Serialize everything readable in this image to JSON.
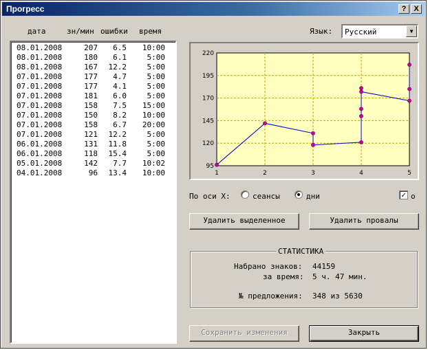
{
  "window": {
    "title": "Прогресс",
    "help_label": "?",
    "close_label": "X"
  },
  "list": {
    "headers": {
      "date": "дата",
      "speed": "зн/мин",
      "errors": "ошибки",
      "time": "время"
    },
    "rows": [
      {
        "date": "08.01.2008",
        "speed": "207",
        "errors": "6.5",
        "time": "10:00"
      },
      {
        "date": "08.01.2008",
        "speed": "180",
        "errors": "6.1",
        "time": "5:00"
      },
      {
        "date": "08.01.2008",
        "speed": "167",
        "errors": "12.2",
        "time": "5:00"
      },
      {
        "date": "07.01.2008",
        "speed": "177",
        "errors": "4.7",
        "time": "5:00"
      },
      {
        "date": "07.01.2008",
        "speed": "177",
        "errors": "4.1",
        "time": "5:00"
      },
      {
        "date": "07.01.2008",
        "speed": "181",
        "errors": "6.0",
        "time": "5:00"
      },
      {
        "date": "07.01.2008",
        "speed": "158",
        "errors": "7.5",
        "time": "15:00"
      },
      {
        "date": "07.01.2008",
        "speed": "150",
        "errors": "8.2",
        "time": "10:00"
      },
      {
        "date": "07.01.2008",
        "speed": "158",
        "errors": "6.7",
        "time": "20:00"
      },
      {
        "date": "07.01.2008",
        "speed": "121",
        "errors": "12.2",
        "time": "5:00"
      },
      {
        "date": "06.01.2008",
        "speed": "131",
        "errors": "11.8",
        "time": "5:00"
      },
      {
        "date": "06.01.2008",
        "speed": "118",
        "errors": "15.4",
        "time": "5:00"
      },
      {
        "date": "05.01.2008",
        "speed": "142",
        "errors": "7.7",
        "time": "10:02"
      },
      {
        "date": "04.01.2008",
        "speed": "96",
        "errors": "13.4",
        "time": "10:00"
      }
    ]
  },
  "language": {
    "label": "Язык:",
    "selected": "Русский"
  },
  "chart_data": {
    "type": "line",
    "x_ticks": [
      "1",
      "2",
      "3",
      "4",
      "5"
    ],
    "y_ticks": [
      "95",
      "120",
      "145",
      "170",
      "195",
      "220"
    ],
    "ylim": [
      95,
      220
    ],
    "xlim": [
      1,
      5
    ],
    "grid": true,
    "plot_background": "#ffffc0",
    "line_color": "#0000cc",
    "marker_color": "#cc0099",
    "points": [
      {
        "x": 1,
        "y": 96
      },
      {
        "x": 2,
        "y": 142
      },
      {
        "x": 3,
        "y": 131
      },
      {
        "x": 3,
        "y": 118
      },
      {
        "x": 4,
        "y": 121
      },
      {
        "x": 4,
        "y": 150
      },
      {
        "x": 4,
        "y": 158
      },
      {
        "x": 4,
        "y": 181
      },
      {
        "x": 4,
        "y": 177
      },
      {
        "x": 5,
        "y": 167
      },
      {
        "x": 5,
        "y": 180
      },
      {
        "x": 5,
        "y": 207
      }
    ]
  },
  "axis_mode": {
    "label": "По оси X:",
    "option_sessions": "сеансы",
    "option_days": "дни",
    "selected": "дни"
  },
  "checkbox": {
    "label": "о",
    "checked": true,
    "mark": "✓"
  },
  "buttons": {
    "delete_selected": "Удалить выделенное",
    "delete_failures": "Удалить провалы",
    "save_changes": "Сохранить изменения",
    "close": "Закрыть"
  },
  "stats": {
    "title": "СТАТИСТИКА",
    "typed_label": "Набрано знаков:",
    "typed_value": "44159",
    "time_label": "за время:",
    "time_value": "5 ч. 47 мин.",
    "sentence_label": "№ предложения:",
    "sentence_value": "348 из 5630"
  },
  "icons": {
    "dropdown": "chevron-down-icon",
    "radio": "radio-icon",
    "check": "check-icon"
  }
}
